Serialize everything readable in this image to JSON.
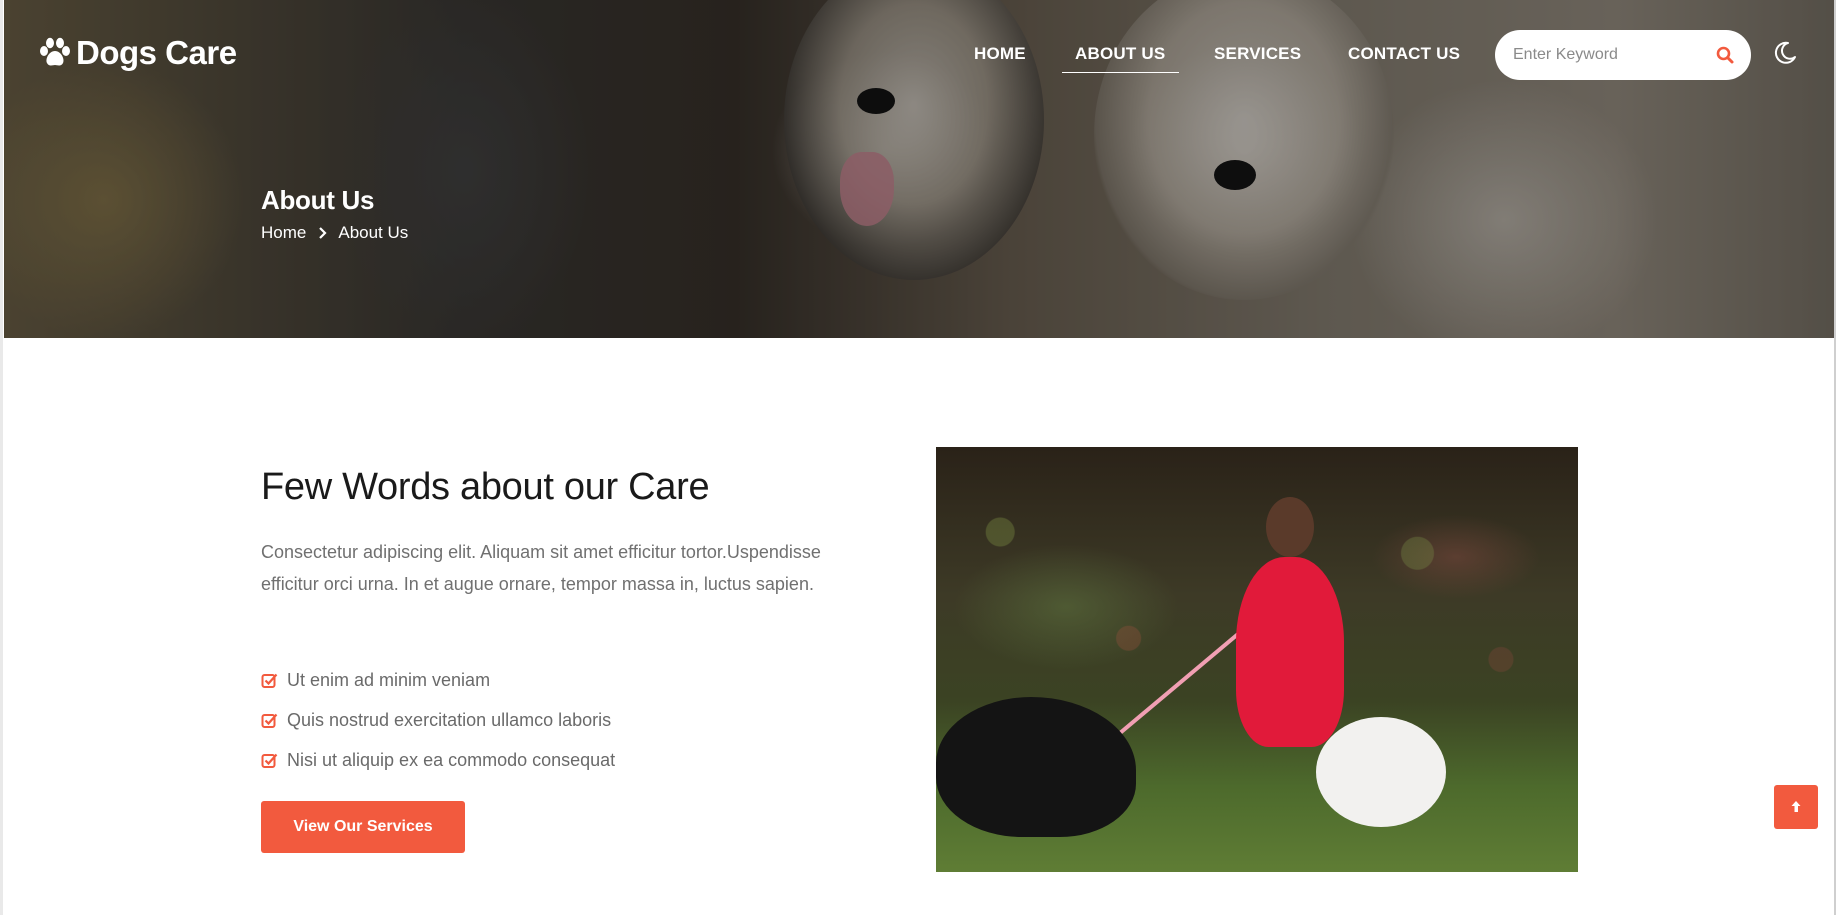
{
  "brand": {
    "name": "Dogs Care",
    "icon": "paw-icon",
    "accent_color": "#f25a3e"
  },
  "nav": {
    "items": [
      {
        "label": "HOME"
      },
      {
        "label": "ABOUT US",
        "active": true
      },
      {
        "label": "SERVICES"
      },
      {
        "label": "CONTACT US"
      }
    ],
    "search_placeholder": "Enter Keyword",
    "search_icon": "search-icon",
    "theme_toggle_icon": "moon-icon"
  },
  "hero": {
    "title": "About Us",
    "breadcrumb": [
      "Home",
      "About Us"
    ],
    "breadcrumb_separator_icon": "chevron-right-icon"
  },
  "about": {
    "heading": "Few Words about our Care",
    "paragraph": "Consectetur adipiscing elit. Aliquam sit amet efficitur tortor.Uspendisse efficitur orci urna. In et augue ornare, tempor massa in, luctus sapien.",
    "list_icon": "check-square-icon",
    "list": [
      "Ut enim ad minim veniam",
      "Quis nostrud exercitation ullamco laboris",
      "Nisi ut aliquip ex ea commodo consequat"
    ],
    "cta_label": "View Our Services"
  },
  "back_to_top_icon": "arrow-up-icon"
}
